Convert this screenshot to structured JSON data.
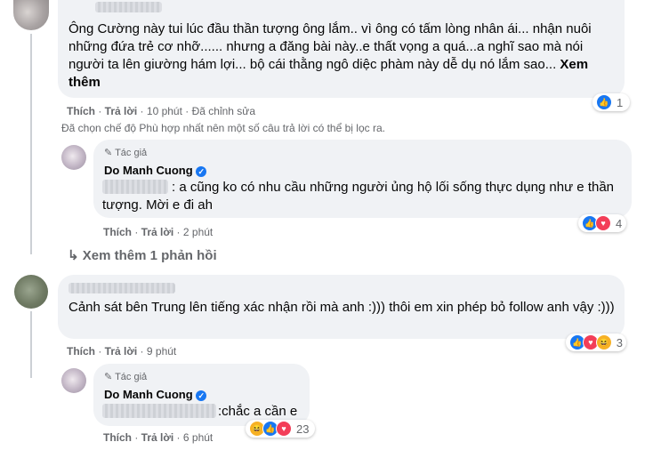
{
  "comments": [
    {
      "text": "Ông Cường này tui lúc đầu thần tượng ông lắm.. vì ông có tấm lòng nhân ái... nhận nuôi những đứa trẻ cơ nhỡ...... nhưng a đăng bài này..e thất vọng a quá...a nghĩ sao mà nói người ta lên giường hám lợi... bộ cái thằng ngô diệc phàm này dễ dụ nó lắm sao...",
      "see_more": "Xem thêm",
      "like": "Thích",
      "reply": "Trả lời",
      "time": "10 phút",
      "edited": "· Đã chỉnh sửa",
      "reaction_count": "1"
    },
    {
      "text": "Cảnh sát bên Trung lên tiếng xác nhận rồi mà anh :))) thôi em xin phép bỏ follow anh vậy :)))",
      "like": "Thích",
      "reply": "Trả lời",
      "time": "9 phút",
      "reaction_count": "3"
    }
  ],
  "filter_notice": "Đã chọn chế độ Phù hợp nhất nên một số câu trả lời có thể bị lọc ra.",
  "replies": [
    {
      "author_tag": "Tác giả",
      "name": "Do Manh Cuong",
      "text": ": a cũng ko có nhu cầu những người ủng hộ lối sống thực dụng như e thần tượng. Mời e đi ah",
      "like": "Thích",
      "reply": "Trả lời",
      "time": "2 phút",
      "reaction_count": "4"
    },
    {
      "author_tag": "Tác giả",
      "name": "Do Manh Cuong",
      "text": ":chắc a cần e",
      "like": "Thích",
      "reply": "Trả lời",
      "time": "6 phút",
      "reaction_count": "23"
    }
  ],
  "more_replies": "Xem thêm 1 phản hồi",
  "colors": {
    "accent": "#1877f2",
    "bubble": "#f0f2f5",
    "meta": "#65676b"
  }
}
